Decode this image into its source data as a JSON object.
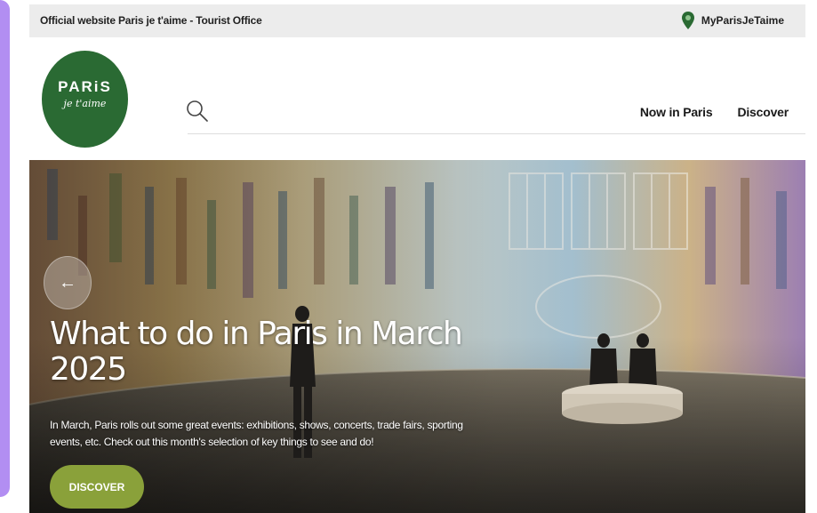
{
  "topbar": {
    "site_name": "Official website Paris je t'aime - Tourist Office",
    "account_label": "MyParisJeTaime"
  },
  "logo": {
    "title": "PARiS",
    "subtitle": "je t'aime"
  },
  "nav": {
    "items": [
      {
        "label": "Now in Paris"
      },
      {
        "label": "Discover"
      }
    ]
  },
  "hero": {
    "title": "What to do in Paris in March 2025",
    "description": "In March, Paris rolls out some great events: exhibitions, shows, concerts, trade fairs, sporting events, etc. Check out this month's selection of key things to see and do!",
    "cta_label": "DISCOVER",
    "prev_icon": "arrow-left-icon"
  },
  "colors": {
    "brand_green": "#2a6a33",
    "cta_green": "#8aa13a",
    "topbar_bg": "#ececec",
    "side_panel": "#b28ef2"
  }
}
